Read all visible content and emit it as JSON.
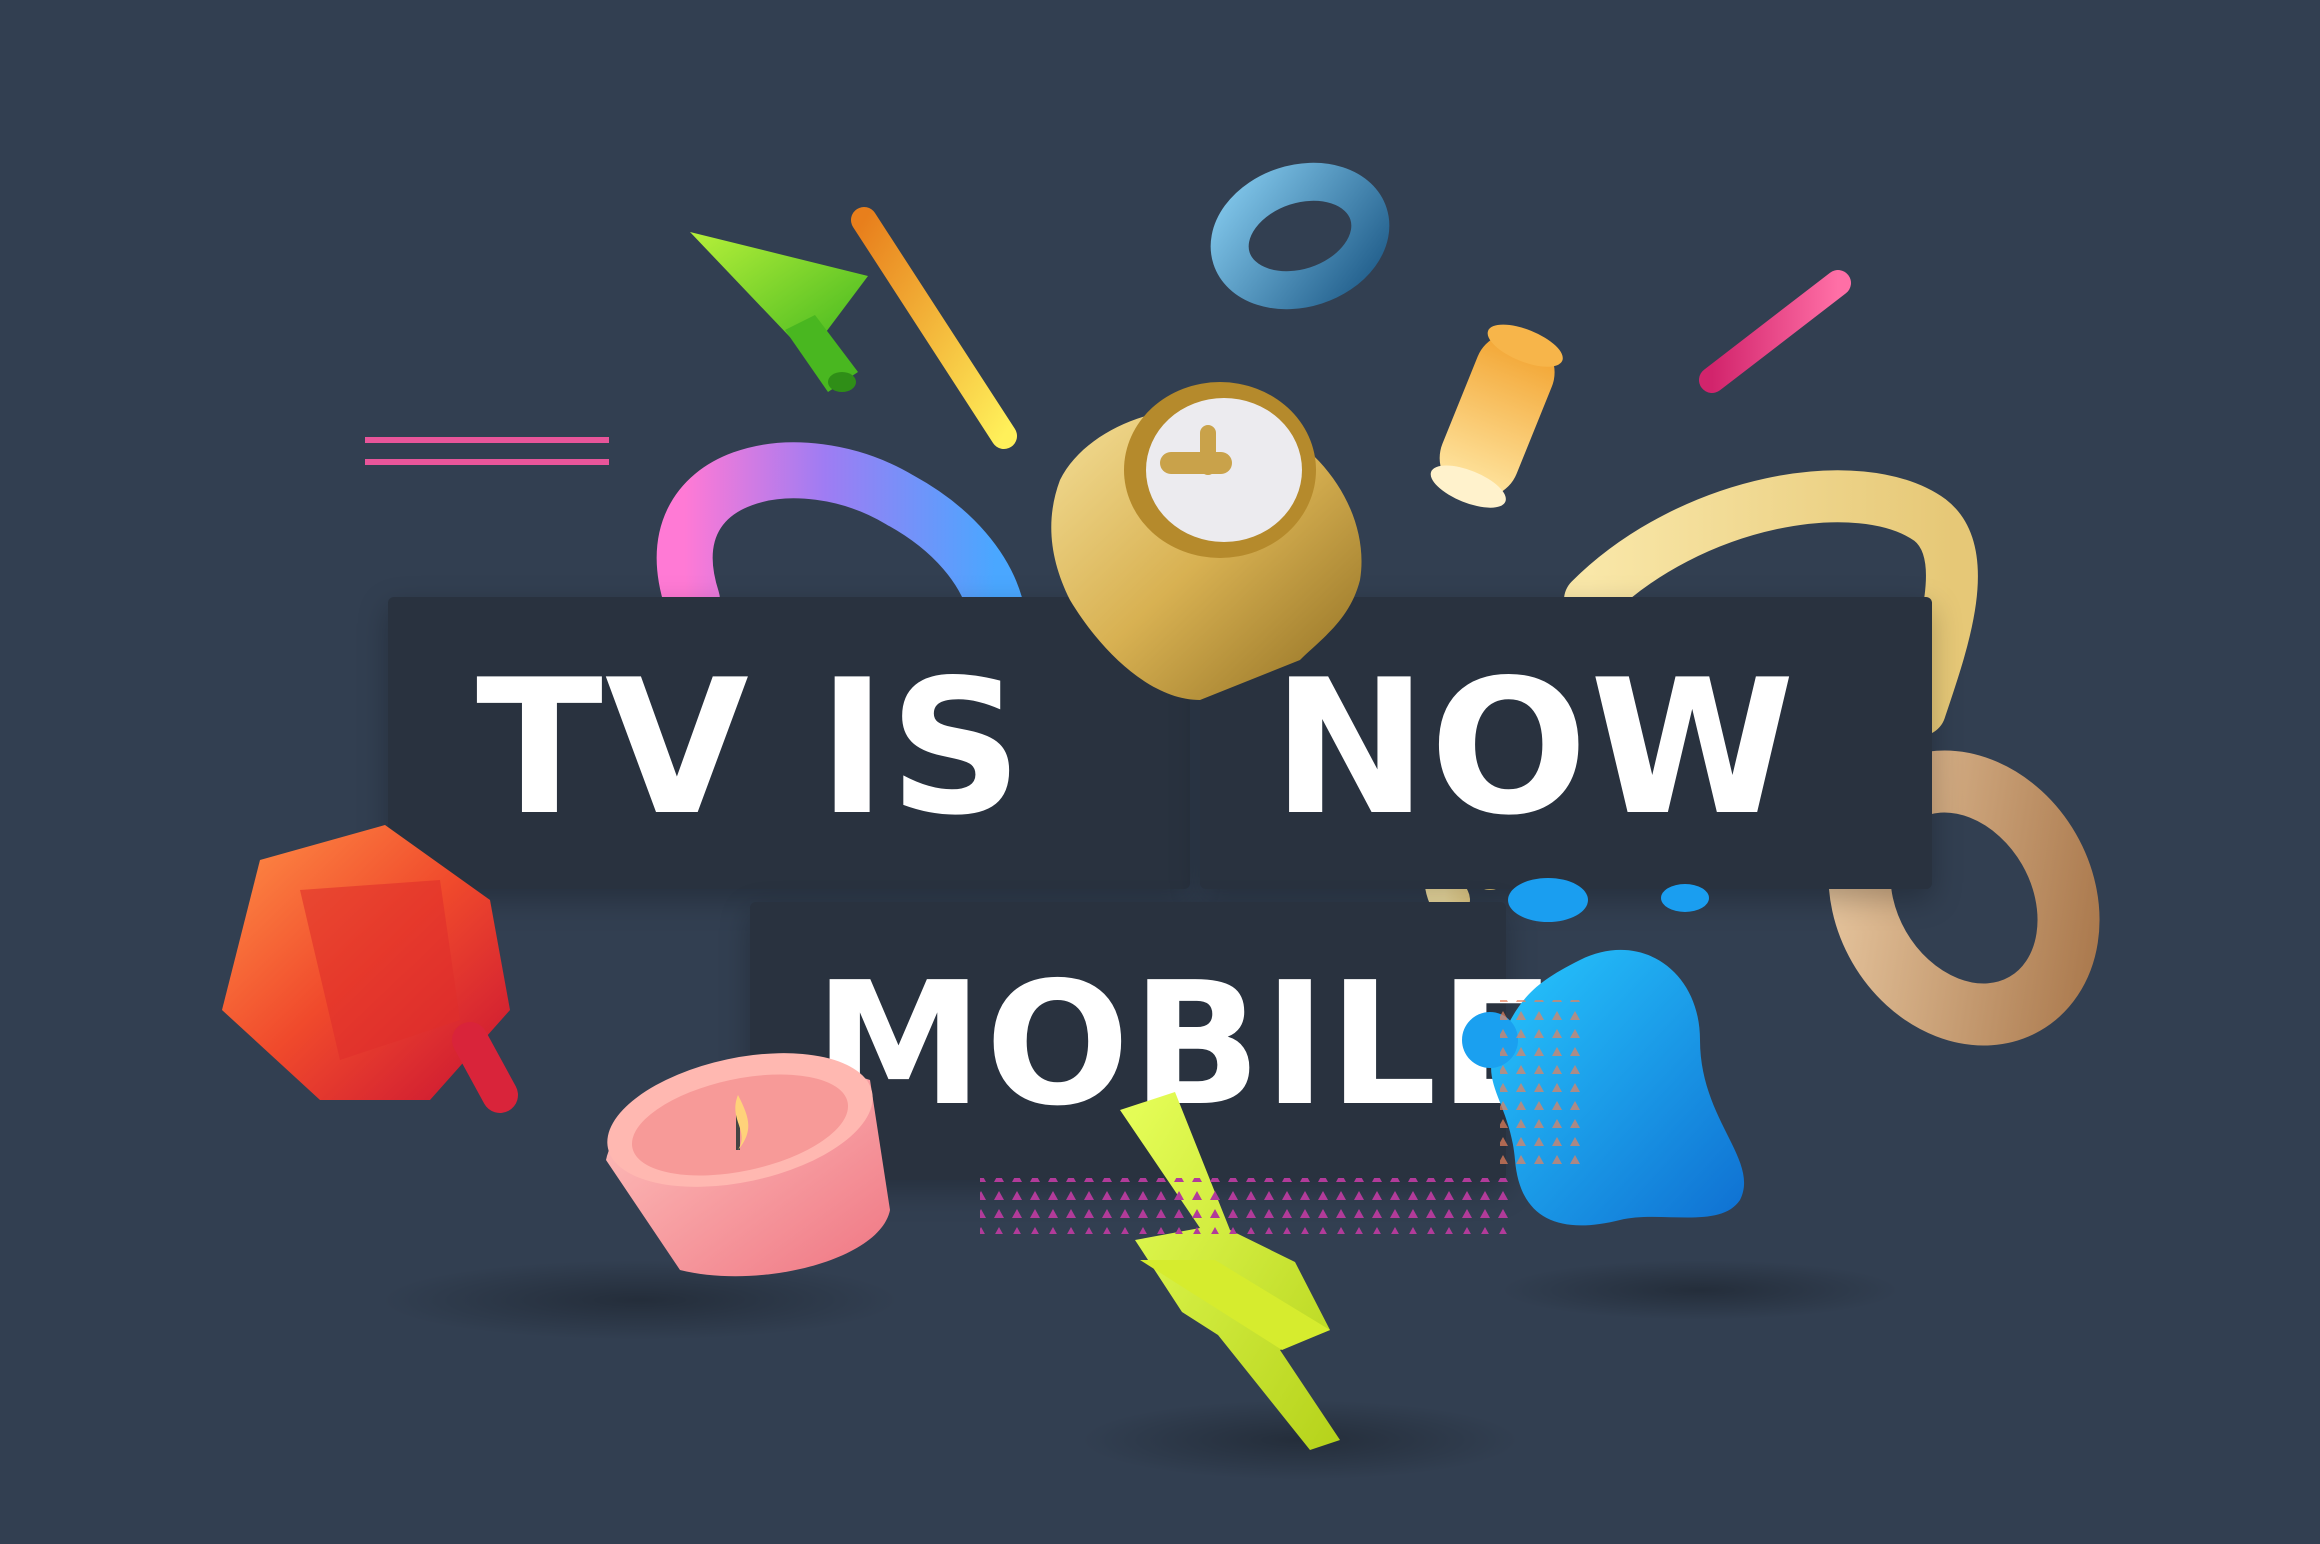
{
  "headline": {
    "line1_left": "TV IS",
    "line1_right": "NOW",
    "line2": "MOBILE"
  },
  "colors": {
    "background": "#323f51",
    "text_box": "#29323f",
    "text": "#ffffff",
    "accent_pink": "#e8559a"
  },
  "decorations": [
    "green-cursor-arrow-icon",
    "yellow-stick-icon",
    "blue-ring-icon",
    "pink-stick-icon",
    "gold-clock-icon",
    "orange-cylinder-icon",
    "rainbow-arc-icon",
    "cream-arc-icon",
    "wooden-ring-icon",
    "red-gem-icon",
    "pink-candle-icon",
    "blue-blob-icon",
    "lightning-bolt-icon",
    "pink-double-line-icon",
    "dotted-triangle-pattern-icon"
  ]
}
